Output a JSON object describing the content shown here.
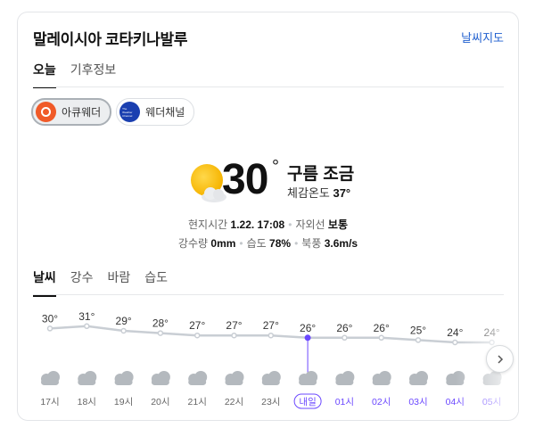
{
  "header": {
    "title": "말레이시아 코타키나발루",
    "map_link": "날씨지도"
  },
  "top_tabs": [
    {
      "label": "오늘",
      "active": true
    },
    {
      "label": "기후정보",
      "active": false
    }
  ],
  "providers": [
    {
      "name": "아큐웨더",
      "active": true,
      "icon": "accuweather-logo"
    },
    {
      "name": "웨더채널",
      "active": false,
      "icon": "weather-channel-logo"
    }
  ],
  "current": {
    "icon": "partly-cloudy-sun-icon",
    "temp": "30",
    "degree": "°",
    "condition": "구름 조금",
    "feels_label": "체감온도",
    "feels_value": "37°"
  },
  "details": {
    "time_label": "현지시간",
    "time_value": "1.22. 17:08",
    "uv_label": "자외선",
    "uv_value": "보통",
    "rain_label": "강수량",
    "rain_value": "0mm",
    "humidity_label": "습도",
    "humidity_value": "78%",
    "wind_label": "북풍",
    "wind_value": "3.6m/s"
  },
  "hour_tabs": [
    {
      "label": "날씨",
      "active": true
    },
    {
      "label": "강수",
      "active": false
    },
    {
      "label": "바람",
      "active": false
    },
    {
      "label": "습도",
      "active": false
    }
  ],
  "hourly": [
    {
      "time": "17시",
      "temp": 30,
      "icon": "cloud-icon"
    },
    {
      "time": "18시",
      "temp": 31,
      "icon": "cloud-icon"
    },
    {
      "time": "19시",
      "temp": 29,
      "icon": "cloud-icon"
    },
    {
      "time": "20시",
      "temp": 28,
      "icon": "cloud-icon"
    },
    {
      "time": "21시",
      "temp": 27,
      "icon": "cloud-icon"
    },
    {
      "time": "22시",
      "temp": 27,
      "icon": "cloud-icon"
    },
    {
      "time": "23시",
      "temp": 27,
      "icon": "cloud-icon"
    },
    {
      "time": "내일",
      "temp": 26,
      "icon": "cloud-icon",
      "marker": true
    },
    {
      "time": "01시",
      "temp": 26,
      "icon": "cloud-icon",
      "next_day": true
    },
    {
      "time": "02시",
      "temp": 26,
      "icon": "cloud-icon",
      "next_day": true
    },
    {
      "time": "03시",
      "temp": 25,
      "icon": "cloud-icon",
      "next_day": true
    },
    {
      "time": "04시",
      "temp": 24,
      "icon": "cloud-icon",
      "next_day": true
    },
    {
      "time": "05시",
      "temp": 24,
      "icon": "cloud-icon",
      "next_day": true
    }
  ],
  "colors": {
    "accent": "#6b48ff",
    "line": "#c9ced4",
    "link": "#1f5fcf",
    "cloud": "#b4b9be"
  }
}
